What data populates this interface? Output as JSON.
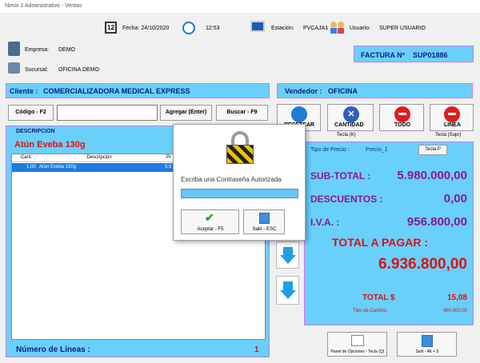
{
  "window": {
    "title": "Nimix 1 Administrativo - Ventas"
  },
  "header": {
    "date_label": "Fecha: 24/10/2020",
    "time": "12:53",
    "station_label": "Estación:",
    "station": "PVCAJA1",
    "user_label": "Usuario:",
    "user": "SUPER USUARIO",
    "company_label": "Empresa:",
    "company": "DEMO",
    "branch_label": "Sucursal:",
    "branch": "OFICINA DEMO"
  },
  "invoice": {
    "label": "FACTURA Nº",
    "number": "SUP01886"
  },
  "client": {
    "label": "Cliente :",
    "name": "COMERCIALIZADORA MEDICAL EXPRESS"
  },
  "seller": {
    "label": "Vendedor :",
    "name": "OFICINA"
  },
  "toolbar": {
    "code_button": "Código - F2",
    "code_value": "",
    "add_button": "Agregar (Enter)",
    "search_button": "Buscar - F9"
  },
  "actions": {
    "reset_label": "RESETEAR",
    "quantity_label": "CANTIDAD",
    "quantity_hint": "Tecla (K)",
    "all_label": "TODO",
    "line_label": "LINEA",
    "line_hint": "Tecla (Supr)"
  },
  "product": {
    "description_label": "DESCRIPCION",
    "name": "Atún Eveba 130g",
    "columns": [
      "Cant.",
      "Descripción",
      "Pr"
    ],
    "rows": [
      {
        "qty": "1,00",
        "desc": "Atún Eveba 130g",
        "price": "5,9"
      }
    ]
  },
  "lines": {
    "label": "Número de Líneas :",
    "count": "1"
  },
  "totals": {
    "price_type_label": "Tipo de Precio :",
    "price_type": "Precio_1",
    "price_key": "Tecla P",
    "subtotal_label": "SUB-TOTAL :",
    "subtotal": "5.980.000,00",
    "discounts_label": "DESCUENTOS :",
    "discounts": "0,00",
    "iva_label": "I.V.A.  :",
    "iva": "956.800,00",
    "total_label": "TOTAL A PAGAR :",
    "total": "6.936.800,00",
    "total_usd_label": "TOTAL $",
    "total_usd": "15,08",
    "exchange_label": "Tipo de Cambio:",
    "exchange": "460.000,00"
  },
  "bottom_buttons": {
    "options": "Panel de Opciones - Tecla (Q)",
    "exit": "Salir - Alt + S"
  },
  "dialog": {
    "prompt": "Escriba una Contraseña Autorizada",
    "password": "",
    "accept": "Aceptar - F5",
    "exit": "Salir - ESC"
  }
}
